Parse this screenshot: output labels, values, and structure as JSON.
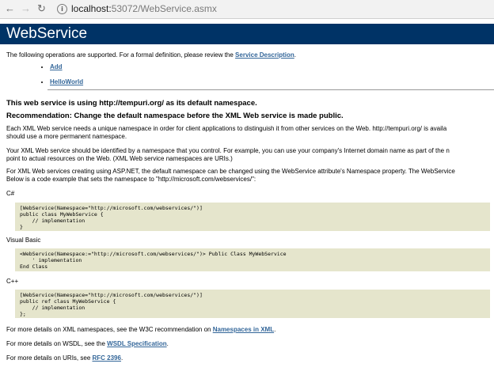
{
  "browser": {
    "url_host": "localhost:",
    "url_rest": "53072/WebService.asmx"
  },
  "page": {
    "heading": "WebService",
    "intro_text": "The following operations are supported. For a formal definition, please review the ",
    "service_description_link": "Service Description",
    "intro_end": ".",
    "operations": [
      "Add",
      "HelloWorld"
    ],
    "namespace_heading": "This web service is using http://tempuri.org/ as its default namespace.",
    "recommendation_heading": "Recommendation: Change the default namespace before the XML Web service is made public.",
    "para1_line1": "Each XML Web service needs a unique namespace in order for client applications to distinguish it from other services on the Web. http://tempuri.org/ is availa",
    "para1_line2": "should use a more permanent namespace.",
    "para2_line1": "Your XML Web service should be identified by a namespace that you control. For example, you can use your company's Internet domain name as part of the n",
    "para2_line2": "point to actual resources on the Web. (XML Web service namespaces are URIs.)",
    "para3_line1": "For XML Web services creating using ASP.NET, the default namespace can be changed using the WebService attribute's Namespace property. The WebService",
    "para3_line2": "Below is a code example that sets the namespace to \"http://microsoft.com/webservices/\":",
    "lang_csharp": "C#",
    "code_csharp": "[WebService(Namespace=\"http://microsoft.com/webservices/\")]\npublic class MyWebService {\n    // implementation\n}",
    "lang_vb": "Visual Basic",
    "code_vb": "<WebService(Namespace:=\"http://microsoft.com/webservices/\")> Public Class MyWebService\n    ' implementation\nEnd Class",
    "lang_cpp": "C++",
    "code_cpp": "[WebService(Namespace=\"http://microsoft.com/webservices/\")]\npublic ref class MyWebService {\n    // implementation\n};",
    "more_xml_text": "For more details on XML namespaces, see the W3C recommendation on ",
    "more_xml_link": "Namespaces in XML",
    "more_wsdl_text": "For more details on WSDL, see the ",
    "more_wsdl_link": "WSDL Specification",
    "more_uri_text": "For more details on URIs, see ",
    "more_uri_link": "RFC 2396",
    "period": "."
  }
}
